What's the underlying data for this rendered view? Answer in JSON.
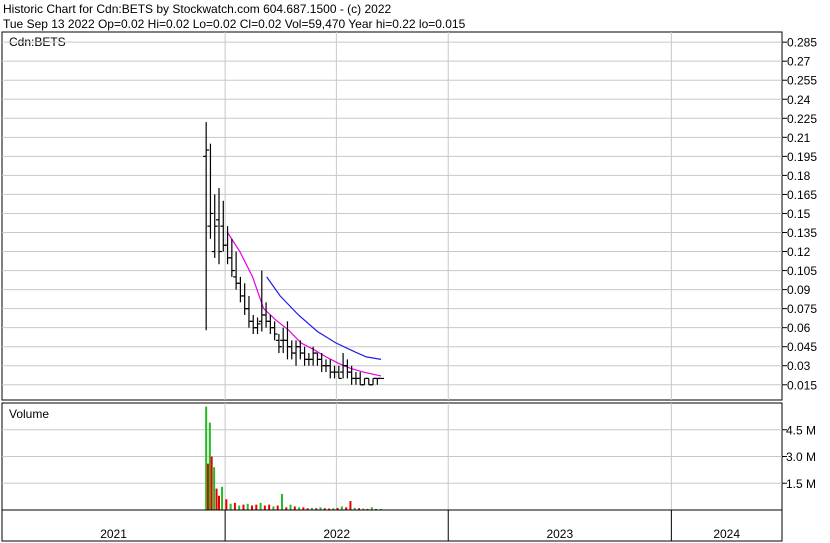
{
  "header": {
    "line1": "Historic Chart for Cdn:BETS by Stockwatch.com 604.687.1500 - (c) 2022",
    "line2": "Tue Sep 13 2022  Op=0.02  Hi=0.02  Lo=0.02  Cl=0.02  Vol=59,470  Year hi=0.22  lo=0.015"
  },
  "colors": {
    "background": "#ffffff",
    "grid": "#c8c8c8",
    "price_bars": "#000000",
    "ma_short": "#e600e6",
    "ma_long": "#1e1ee6",
    "volume_up": "#22bb22",
    "volume_down": "#e60000"
  },
  "chart_data": [
    {
      "type": "bar",
      "panel_label": "Cdn:BETS",
      "y_ticks": [
        "0.285",
        "0.27",
        "0.255",
        "0.24",
        "0.225",
        "0.21",
        "0.195",
        "0.18",
        "0.165",
        "0.15",
        "0.135",
        "0.12",
        "0.105",
        "0.09",
        "0.075",
        "0.06",
        "0.045",
        "0.03",
        "0.015"
      ],
      "ylim": [
        0.003,
        0.293
      ],
      "x_labels": [
        "2021",
        "2022",
        "2023",
        "2024"
      ],
      "xlim": [
        "2021-01-01",
        "2024-06-30"
      ],
      "grid": true,
      "price_range": {
        "start": "2021-12-01",
        "end": "2022-09-13"
      },
      "series": [
        {
          "values_by_date": [
            [
              "2021-12-01",
              0.058,
              0.222,
              0.195,
              0.2
            ],
            [
              "2021-12-08",
              0.13,
              0.205,
              0.14,
              0.15
            ],
            [
              "2021-12-15",
              0.115,
              0.165,
              0.12,
              0.14
            ],
            [
              "2021-12-22",
              0.11,
              0.17,
              0.145,
              0.12
            ],
            [
              "2021-12-29",
              0.12,
              0.16,
              0.14,
              0.125
            ],
            [
              "2022-01-05",
              0.11,
              0.14,
              0.125,
              0.115
            ],
            [
              "2022-01-12",
              0.1,
              0.13,
              0.115,
              0.105
            ],
            [
              "2022-01-19",
              0.09,
              0.12,
              0.1,
              0.095
            ],
            [
              "2022-01-26",
              0.08,
              0.1,
              0.095,
              0.085
            ],
            [
              "2022-02-02",
              0.07,
              0.095,
              0.085,
              0.075
            ],
            [
              "2022-02-09",
              0.06,
              0.085,
              0.075,
              0.065
            ],
            [
              "2022-02-16",
              0.055,
              0.07,
              0.065,
              0.06
            ],
            [
              "2022-02-23",
              0.055,
              0.068,
              0.06,
              0.063
            ],
            [
              "2022-03-02",
              0.057,
              0.105,
              0.065,
              0.07
            ],
            [
              "2022-03-09",
              0.06,
              0.08,
              0.07,
              0.065
            ],
            [
              "2022-03-16",
              0.055,
              0.07,
              0.065,
              0.06
            ],
            [
              "2022-03-23",
              0.05,
              0.065,
              0.06,
              0.055
            ],
            [
              "2022-03-30",
              0.04,
              0.055,
              0.05,
              0.045
            ],
            [
              "2022-04-06",
              0.04,
              0.06,
              0.05,
              0.05
            ],
            [
              "2022-04-13",
              0.035,
              0.065,
              0.05,
              0.045
            ],
            [
              "2022-04-20",
              0.035,
              0.05,
              0.045,
              0.04
            ],
            [
              "2022-04-27",
              0.03,
              0.05,
              0.04,
              0.045
            ],
            [
              "2022-05-04",
              0.035,
              0.05,
              0.045,
              0.04
            ],
            [
              "2022-05-11",
              0.03,
              0.045,
              0.04,
              0.035
            ],
            [
              "2022-05-18",
              0.03,
              0.04,
              0.035,
              0.035
            ],
            [
              "2022-05-25",
              0.03,
              0.045,
              0.035,
              0.04
            ],
            [
              "2022-06-01",
              0.03,
              0.04,
              0.04,
              0.035
            ],
            [
              "2022-06-08",
              0.025,
              0.04,
              0.035,
              0.03
            ],
            [
              "2022-06-15",
              0.025,
              0.035,
              0.03,
              0.03
            ],
            [
              "2022-06-22",
              0.02,
              0.035,
              0.03,
              0.025
            ],
            [
              "2022-06-29",
              0.02,
              0.03,
              0.025,
              0.025
            ],
            [
              "2022-07-06",
              0.02,
              0.03,
              0.025,
              0.02
            ],
            [
              "2022-07-13",
              0.02,
              0.04,
              0.025,
              0.03
            ],
            [
              "2022-07-20",
              0.02,
              0.035,
              0.03,
              0.025
            ],
            [
              "2022-07-27",
              0.015,
              0.03,
              0.025,
              0.02
            ],
            [
              "2022-08-03",
              0.015,
              0.025,
              0.02,
              0.02
            ],
            [
              "2022-08-10",
              0.015,
              0.025,
              0.02,
              0.015
            ],
            [
              "2022-08-17",
              0.015,
              0.02,
              0.015,
              0.02
            ],
            [
              "2022-08-24",
              0.015,
              0.02,
              0.02,
              0.015
            ],
            [
              "2022-08-31",
              0.015,
              0.02,
              0.015,
              0.02
            ],
            [
              "2022-09-07",
              0.015,
              0.02,
              0.02,
              0.02
            ],
            [
              "2022-09-13",
              0.02,
              0.02,
              0.02,
              0.02
            ]
          ]
        },
        {
          "type": "line",
          "values_by_date": [
            [
              "2022-01-05",
              0.135
            ],
            [
              "2022-01-25",
              0.12
            ],
            [
              "2022-02-15",
              0.1
            ],
            [
              "2022-03-05",
              0.075
            ],
            [
              "2022-03-25",
              0.066
            ],
            [
              "2022-04-15",
              0.058
            ],
            [
              "2022-05-05",
              0.048
            ],
            [
              "2022-05-25",
              0.043
            ],
            [
              "2022-06-15",
              0.037
            ],
            [
              "2022-07-05",
              0.032
            ],
            [
              "2022-07-25",
              0.028
            ],
            [
              "2022-08-15",
              0.025
            ],
            [
              "2022-09-13",
              0.022
            ]
          ]
        },
        {
          "type": "line",
          "values_by_date": [
            [
              "2022-03-10",
              0.1
            ],
            [
              "2022-04-01",
              0.085
            ],
            [
              "2022-05-01",
              0.07
            ],
            [
              "2022-06-01",
              0.057
            ],
            [
              "2022-07-01",
              0.048
            ],
            [
              "2022-08-01",
              0.041
            ],
            [
              "2022-08-20",
              0.037
            ],
            [
              "2022-09-13",
              0.035
            ]
          ]
        }
      ]
    },
    {
      "type": "bar",
      "panel_label": "Volume",
      "y_ticks": [
        "4.5 M",
        "3.0 M",
        "1.5 M"
      ],
      "ylim": [
        0,
        6000000
      ],
      "grid": true,
      "series": [
        {
          "values_by_date": [
            [
              "2021-12-01",
              5800000,
              "up"
            ],
            [
              "2021-12-04",
              2600000,
              "down"
            ],
            [
              "2021-12-07",
              4900000,
              "up"
            ],
            [
              "2021-12-10",
              3000000,
              "down"
            ],
            [
              "2021-12-14",
              2400000,
              "up"
            ],
            [
              "2021-12-18",
              1200000,
              "down"
            ],
            [
              "2021-12-22",
              800000,
              "down"
            ],
            [
              "2021-12-27",
              1300000,
              "up"
            ],
            [
              "2022-01-03",
              600000,
              "down"
            ],
            [
              "2022-01-10",
              350000,
              "up"
            ],
            [
              "2022-01-17",
              400000,
              "down"
            ],
            [
              "2022-01-24",
              250000,
              "up"
            ],
            [
              "2022-01-31",
              300000,
              "down"
            ],
            [
              "2022-02-07",
              350000,
              "up"
            ],
            [
              "2022-02-14",
              250000,
              "down"
            ],
            [
              "2022-02-21",
              300000,
              "down"
            ],
            [
              "2022-02-28",
              400000,
              "up"
            ],
            [
              "2022-03-07",
              250000,
              "down"
            ],
            [
              "2022-03-14",
              300000,
              "down"
            ],
            [
              "2022-03-21",
              200000,
              "up"
            ],
            [
              "2022-03-28",
              250000,
              "down"
            ],
            [
              "2022-04-04",
              900000,
              "up"
            ],
            [
              "2022-04-11",
              150000,
              "down"
            ],
            [
              "2022-04-18",
              300000,
              "up"
            ],
            [
              "2022-04-25",
              200000,
              "down"
            ],
            [
              "2022-05-02",
              150000,
              "up"
            ],
            [
              "2022-05-09",
              150000,
              "down"
            ],
            [
              "2022-05-16",
              100000,
              "down"
            ],
            [
              "2022-05-23",
              120000,
              "up"
            ],
            [
              "2022-05-30",
              100000,
              "down"
            ],
            [
              "2022-06-06",
              150000,
              "up"
            ],
            [
              "2022-06-13",
              100000,
              "down"
            ],
            [
              "2022-06-20",
              80000,
              "down"
            ],
            [
              "2022-06-27",
              100000,
              "up"
            ],
            [
              "2022-07-04",
              120000,
              "down"
            ],
            [
              "2022-07-11",
              200000,
              "up"
            ],
            [
              "2022-07-18",
              150000,
              "down"
            ],
            [
              "2022-07-25",
              500000,
              "down"
            ],
            [
              "2022-08-01",
              120000,
              "up"
            ],
            [
              "2022-08-08",
              100000,
              "down"
            ],
            [
              "2022-08-15",
              80000,
              "up"
            ],
            [
              "2022-08-22",
              60000,
              "down"
            ],
            [
              "2022-08-29",
              150000,
              "up"
            ],
            [
              "2022-09-05",
              60000,
              "down"
            ],
            [
              "2022-09-13",
              59470,
              "up"
            ]
          ]
        }
      ]
    }
  ]
}
